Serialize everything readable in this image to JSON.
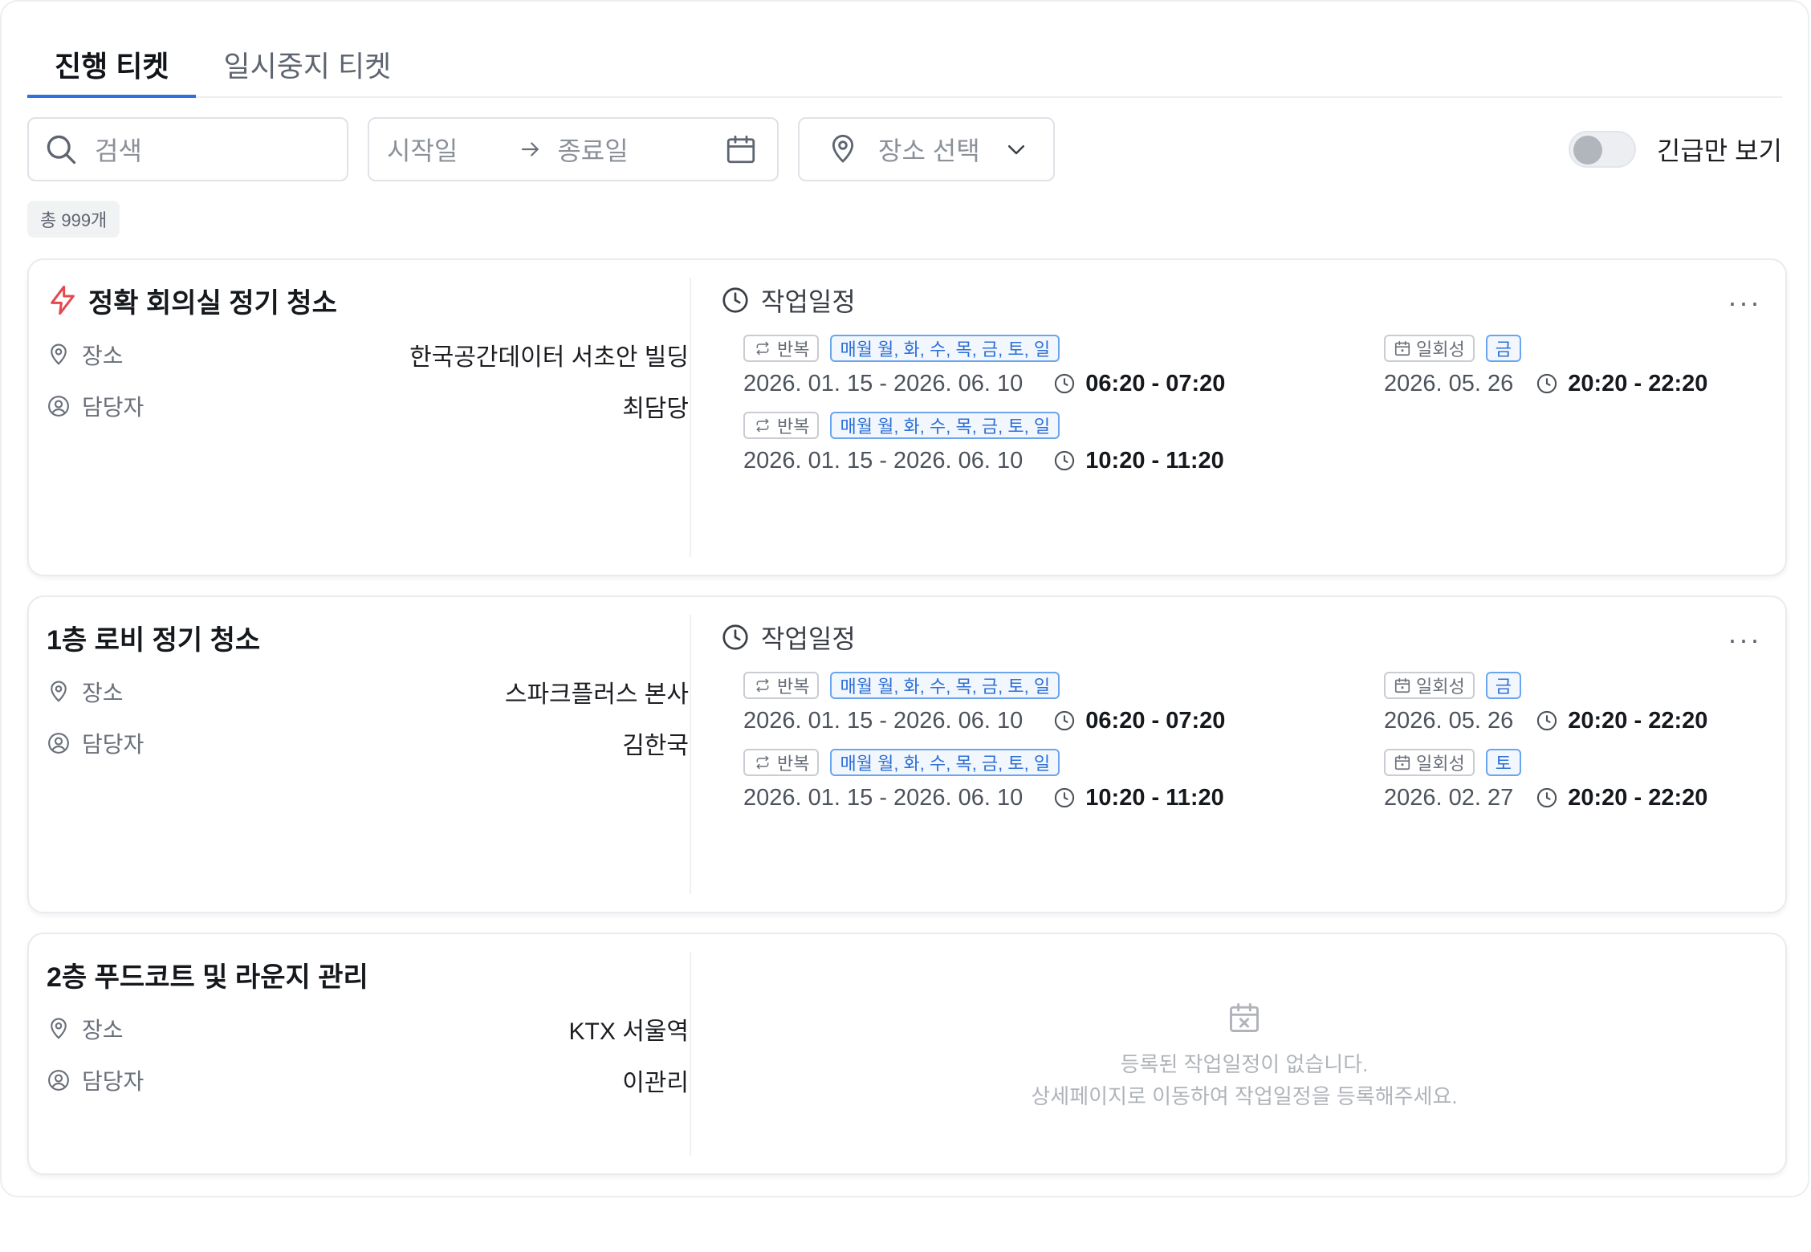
{
  "tabs": [
    {
      "label": "진행 티켓"
    },
    {
      "label": "일시중지 티켓"
    }
  ],
  "filters": {
    "search_placeholder": "검색",
    "start_placeholder": "시작일",
    "end_placeholder": "종료일",
    "place_placeholder": "장소 선택",
    "urgent_toggle_label": "긴급만 보기"
  },
  "total_count": "총 999개",
  "labels": {
    "place": "장소",
    "manager": "담당자",
    "schedule_header": "작업일정",
    "repeat_tag": "반복",
    "once_tag": "일회성"
  },
  "tickets": [
    {
      "title": "정확 회의실 정기 청소",
      "urgent": true,
      "place": "한국공간데이터 서초안 빌딩",
      "manager": "최담당",
      "repeat": [
        {
          "days": "매월 월, 화, 수, 목, 금, 토, 일",
          "range": "2026. 01. 15 - 2026. 06. 10",
          "time": "06:20 - 07:20"
        },
        {
          "days": "매월 월, 화, 수, 목, 금, 토, 일",
          "range": "2026. 01. 15 - 2026. 06. 10",
          "time": "10:20 - 11:20"
        }
      ],
      "once": [
        {
          "day": "금",
          "date": "2026. 05. 26",
          "time": "20:20 - 22:20"
        }
      ]
    },
    {
      "title": "1층 로비 정기 청소",
      "urgent": false,
      "place": "스파크플러스 본사",
      "manager": "김한국",
      "repeat": [
        {
          "days": "매월 월, 화, 수, 목, 금, 토, 일",
          "range": "2026. 01. 15 - 2026. 06. 10",
          "time": "06:20 - 07:20"
        },
        {
          "days": "매월 월, 화, 수, 목, 금, 토, 일",
          "range": "2026. 01. 15 - 2026. 06. 10",
          "time": "10:20 - 11:20"
        }
      ],
      "once": [
        {
          "day": "금",
          "date": "2026. 05. 26",
          "time": "20:20 - 22:20"
        },
        {
          "day": "토",
          "date": "2026. 02. 27",
          "time": "20:20 - 22:20"
        }
      ]
    },
    {
      "title": "2층 푸드코트 및 라운지 관리",
      "urgent": false,
      "place": "KTX 서울역",
      "manager": "이관리",
      "empty_line1": "등록된 작업일정이 없습니다.",
      "empty_line2": "상세페이지로 이동하여 작업일정을 등록해주세요."
    }
  ],
  "icons": {
    "search": "search-icon",
    "arrow": "arrow-right-icon",
    "calendar": "calendar-icon",
    "pin": "location-pin-icon",
    "chevron": "chevron-down-icon",
    "urgent": "lightning-icon",
    "person": "user-circle-icon",
    "clock": "clock-icon",
    "repeat": "repeat-icon",
    "more": "more-icon",
    "empty": "calendar-x-icon"
  },
  "colors": {
    "accent": "#2f6fe4",
    "urgent": "#e5484d",
    "tag_blue": "#2d6fd6"
  }
}
